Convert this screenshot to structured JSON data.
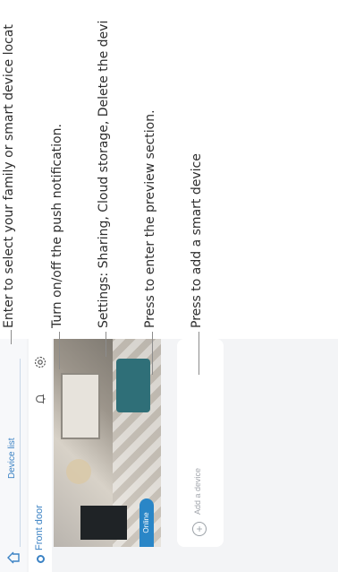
{
  "top_tab": {
    "label": "Device list"
  },
  "device": {
    "name": "Front door",
    "status": "Online"
  },
  "add_device": {
    "label": "Add a device",
    "icon": "plus-circle-icon"
  },
  "callouts": [
    {
      "text": "Enter to select your family or smart device locat"
    },
    {
      "text": "Turn on/off the push notification."
    },
    {
      "text": "Settings: Sharing, Cloud storage, Delete the devi"
    },
    {
      "text": "Press to enter the preview section."
    },
    {
      "text": "Press to add a smart device"
    }
  ],
  "colors": {
    "accent": "#3b82c4",
    "badge": "#2a86c7"
  }
}
